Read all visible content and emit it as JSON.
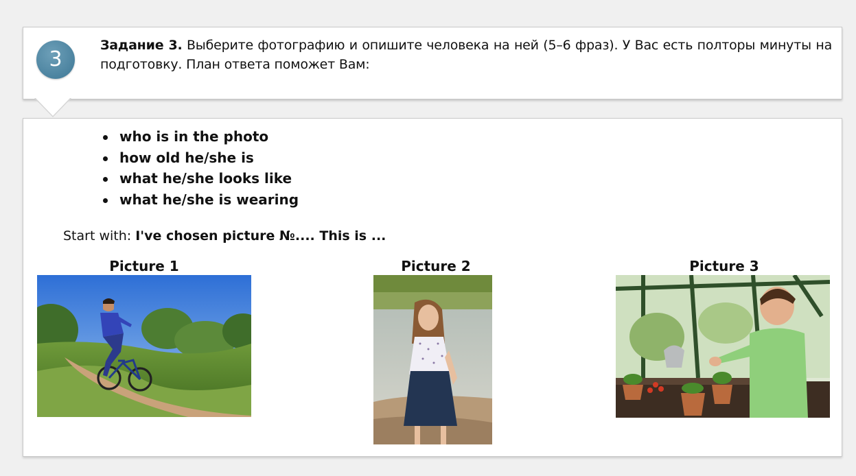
{
  "task": {
    "number": "3",
    "title": "Задание 3.",
    "text": "Выберите фотографию и опишите человека на ней (5–6 фраз). У Вас есть полторы минуты на подготовку. План ответа поможет Вам:"
  },
  "plan": {
    "items": [
      "who is in the photo",
      "how old he/she is",
      "what he/she looks like",
      "what he/she is wearing"
    ]
  },
  "start": {
    "prefix": "Start with:",
    "phrase": "I've chosen picture №.... This is ..."
  },
  "pictures": [
    {
      "caption": "Picture 1",
      "subject": "boy-riding-bicycle"
    },
    {
      "caption": "Picture 2",
      "subject": "girl-by-lake"
    },
    {
      "caption": "Picture 3",
      "subject": "boy-planting-in-greenhouse"
    }
  ]
}
